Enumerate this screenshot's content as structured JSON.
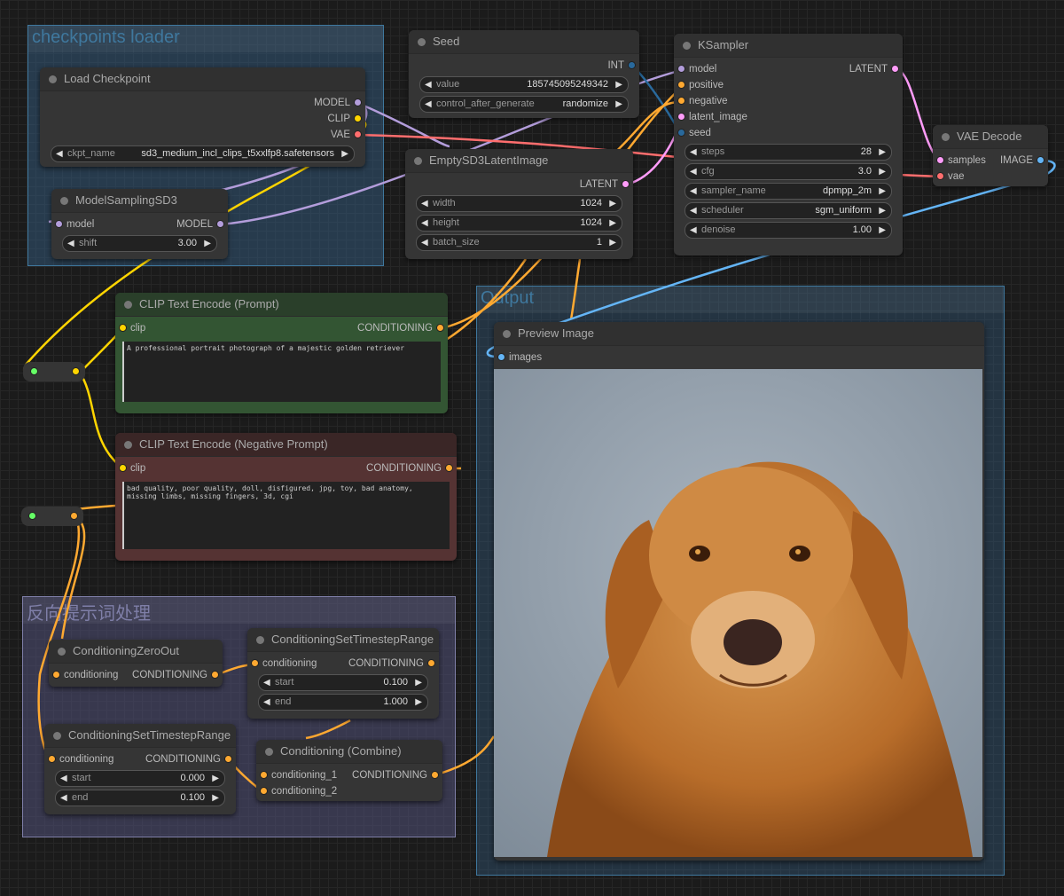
{
  "groups": [
    {
      "id": "g1",
      "title": "checkpoints loader",
      "color": "#3f789e"
    },
    {
      "id": "g2",
      "title": "Output",
      "color": "#3f789e"
    },
    {
      "id": "g3",
      "title": "反向提示词处理",
      "color": "#8080a8"
    }
  ],
  "colors": {
    "MODEL": "#b39ddb",
    "CLIP": "#ffd500",
    "VAE": "#ff6e6e",
    "INT": "#29699c",
    "LATENT": "#ff9cf9",
    "CONDITIONING": "#ffa931",
    "IMAGE": "#64b5f6"
  },
  "nodes": [
    {
      "id": "load_checkpoint",
      "title": "Load Checkpoint",
      "inputs": [],
      "outputs": [
        {
          "label": "MODEL",
          "type": "MODEL"
        },
        {
          "label": "CLIP",
          "type": "CLIP"
        },
        {
          "label": "VAE",
          "type": "VAE"
        }
      ],
      "widgets": [
        {
          "name": "ckpt_name",
          "value": "sd3_medium_incl_clips_t5xxlfp8.safetensors"
        }
      ]
    },
    {
      "id": "model_sampling",
      "title": "ModelSamplingSD3",
      "inputs": [
        {
          "label": "model",
          "type": "MODEL"
        }
      ],
      "outputs": [
        {
          "label": "MODEL",
          "type": "MODEL"
        }
      ],
      "widgets": [
        {
          "name": "shift",
          "value": "3.00"
        }
      ]
    },
    {
      "id": "seed",
      "title": "Seed",
      "inputs": [],
      "outputs": [
        {
          "label": "INT",
          "type": "INT"
        }
      ],
      "widgets": [
        {
          "name": "value",
          "value": "185745095249342"
        },
        {
          "name": "control_after_generate",
          "value": "randomize"
        }
      ]
    },
    {
      "id": "empty_latent",
      "title": "EmptySD3LatentImage",
      "inputs": [],
      "outputs": [
        {
          "label": "LATENT",
          "type": "LATENT"
        }
      ],
      "widgets": [
        {
          "name": "width",
          "value": "1024"
        },
        {
          "name": "height",
          "value": "1024"
        },
        {
          "name": "batch_size",
          "value": "1"
        }
      ]
    },
    {
      "id": "ksampler",
      "title": "KSampler",
      "inputs": [
        {
          "label": "model",
          "type": "MODEL"
        },
        {
          "label": "positive",
          "type": "CONDITIONING"
        },
        {
          "label": "negative",
          "type": "CONDITIONING"
        },
        {
          "label": "latent_image",
          "type": "LATENT"
        },
        {
          "label": "seed",
          "type": "INT"
        }
      ],
      "outputs": [
        {
          "label": "LATENT",
          "type": "LATENT"
        }
      ],
      "widgets": [
        {
          "name": "steps",
          "value": "28"
        },
        {
          "name": "cfg",
          "value": "3.0"
        },
        {
          "name": "sampler_name",
          "value": "dpmpp_2m"
        },
        {
          "name": "scheduler",
          "value": "sgm_uniform"
        },
        {
          "name": "denoise",
          "value": "1.00"
        }
      ]
    },
    {
      "id": "vae_decode",
      "title": "VAE Decode",
      "inputs": [
        {
          "label": "samples",
          "type": "LATENT"
        },
        {
          "label": "vae",
          "type": "VAE"
        }
      ],
      "outputs": [
        {
          "label": "IMAGE",
          "type": "IMAGE"
        }
      ],
      "widgets": []
    },
    {
      "id": "clip_pos",
      "title": "CLIP Text Encode (Prompt)",
      "inputs": [
        {
          "label": "clip",
          "type": "CLIP"
        }
      ],
      "outputs": [
        {
          "label": "CONDITIONING",
          "type": "CONDITIONING"
        }
      ],
      "widgets": [],
      "text": "A professional portrait photograph of a majestic golden retriever",
      "title_bg": "#2a3f2a",
      "body_bg": "#335533"
    },
    {
      "id": "clip_neg",
      "title": "CLIP Text Encode (Negative Prompt)",
      "inputs": [
        {
          "label": "clip",
          "type": "CLIP"
        }
      ],
      "outputs": [
        {
          "label": "CONDITIONING",
          "type": "CONDITIONING"
        }
      ],
      "widgets": [],
      "text": "bad quality, poor quality, doll, disfigured, jpg, toy, bad anatomy,\nmissing limbs, missing fingers, 3d, cgi",
      "title_bg": "#3a2626",
      "body_bg": "#553333"
    },
    {
      "id": "preview",
      "title": "Preview Image",
      "inputs": [
        {
          "label": "images",
          "type": "IMAGE"
        }
      ],
      "outputs": [],
      "widgets": []
    },
    {
      "id": "zero_out",
      "title": "ConditioningZeroOut",
      "inputs": [
        {
          "label": "conditioning",
          "type": "CONDITIONING"
        }
      ],
      "outputs": [
        {
          "label": "CONDITIONING",
          "type": "CONDITIONING"
        }
      ],
      "widgets": []
    },
    {
      "id": "ts_range_1",
      "title": "ConditioningSetTimestepRange",
      "inputs": [
        {
          "label": "conditioning",
          "type": "CONDITIONING"
        }
      ],
      "outputs": [
        {
          "label": "CONDITIONING",
          "type": "CONDITIONING"
        }
      ],
      "widgets": [
        {
          "name": "start",
          "value": "0.100"
        },
        {
          "name": "end",
          "value": "1.000"
        }
      ]
    },
    {
      "id": "ts_range_2",
      "title": "ConditioningSetTimestepRange",
      "inputs": [
        {
          "label": "conditioning",
          "type": "CONDITIONING"
        }
      ],
      "outputs": [
        {
          "label": "CONDITIONING",
          "type": "CONDITIONING"
        }
      ],
      "widgets": [
        {
          "name": "start",
          "value": "0.000"
        },
        {
          "name": "end",
          "value": "0.100"
        }
      ]
    },
    {
      "id": "combine",
      "title": "Conditioning (Combine)",
      "inputs": [
        {
          "label": "conditioning_1",
          "type": "CONDITIONING"
        },
        {
          "label": "conditioning_2",
          "type": "CONDITIONING"
        }
      ],
      "outputs": [
        {
          "label": "CONDITIONING",
          "type": "CONDITIONING"
        }
      ],
      "widgets": []
    }
  ]
}
